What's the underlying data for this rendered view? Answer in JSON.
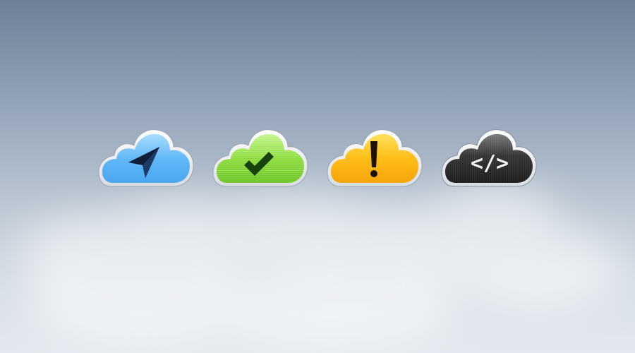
{
  "colors": {
    "sky_top": "#6f7f95",
    "sky_bottom": "#e3e8ee",
    "blue": "#5bb4f5",
    "green": "#86d83a",
    "yellow": "#f7b80f",
    "dark": "#3a3a3a"
  },
  "icons": [
    {
      "name": "navigate-cloud",
      "glyph": "location-arrow-icon",
      "color": "#5bb4f5"
    },
    {
      "name": "success-cloud",
      "glyph": "checkmark-icon",
      "color": "#86d83a"
    },
    {
      "name": "warning-cloud",
      "glyph": "exclamation-icon",
      "color": "#f7b80f"
    },
    {
      "name": "code-cloud",
      "glyph": "code-icon",
      "color": "#3a3a3a",
      "glyph_text": "</>"
    }
  ]
}
